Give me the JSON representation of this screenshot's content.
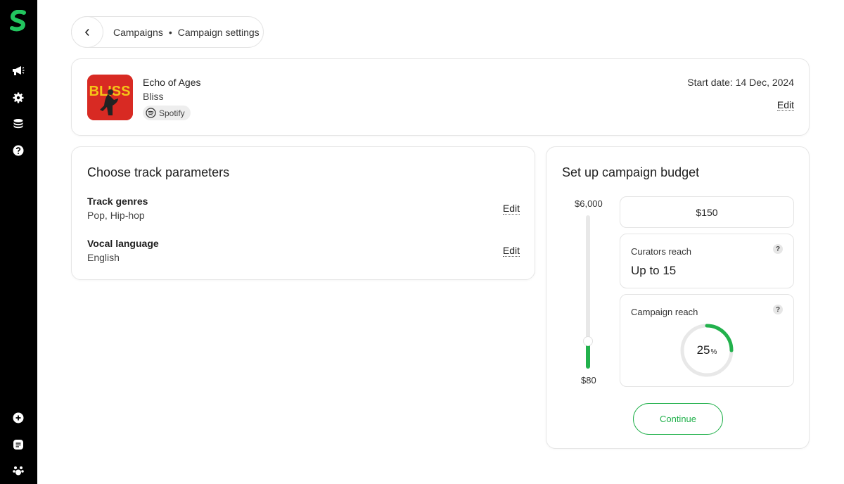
{
  "sidebar": {
    "items": [
      {
        "icon": "megaphone-icon"
      },
      {
        "icon": "settings-gear-icon"
      },
      {
        "icon": "coins-stack-icon"
      },
      {
        "icon": "help-icon"
      }
    ],
    "bottom_items": [
      {
        "icon": "add-circle-icon"
      },
      {
        "icon": "document-icon"
      },
      {
        "icon": "paw-icon"
      }
    ]
  },
  "breadcrumb": {
    "parent": "Campaigns",
    "separator": "•",
    "current": "Campaign settings"
  },
  "track": {
    "title": "Echo of Ages",
    "artist": "Bliss",
    "platform": "Spotify",
    "cover_text": "BLISS",
    "start_date": "Start date: 14 Dec, 2024",
    "edit_label": "Edit"
  },
  "params": {
    "title": "Choose track parameters",
    "items": [
      {
        "label": "Track genres",
        "value": "Pop, Hip-hop",
        "edit": "Edit"
      },
      {
        "label": "Vocal language",
        "value": "English",
        "edit": "Edit"
      }
    ]
  },
  "budget": {
    "title": "Set up campaign budget",
    "slider_max": "$6,000",
    "slider_min": "$80",
    "slider_fraction": 0.18,
    "value": "$150",
    "curators": {
      "label": "Curators reach",
      "value": "Up to 15",
      "help": "?"
    },
    "campaign": {
      "label": "Campaign reach",
      "percent": 25,
      "percent_text": "25",
      "unit": "%",
      "help": "?"
    },
    "continue_label": "Continue"
  },
  "colors": {
    "accent": "#22b14c",
    "sidebar_bg": "#000000",
    "cover_bg": "#d82a23"
  }
}
